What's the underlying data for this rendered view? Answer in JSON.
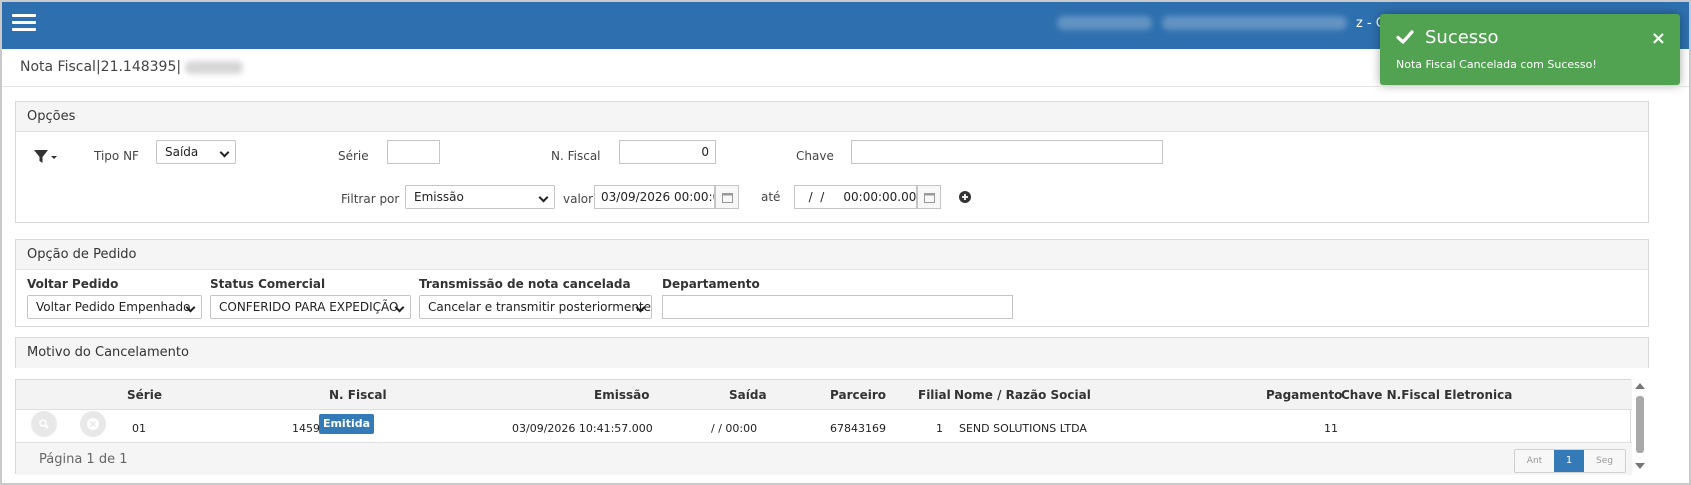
{
  "topbar": {
    "suffix": "z - C"
  },
  "toast": {
    "title": "Sucesso",
    "message": "Nota Fiscal Cancelada com Sucesso!",
    "close": "×",
    "color": "#51a351"
  },
  "page": {
    "title": "Nota Fiscal|21.148395|"
  },
  "opcoes": {
    "heading": "Opções",
    "tipo_nf_label": "Tipo NF",
    "tipo_nf_value": "Saída",
    "serie_label": "Série",
    "serie_value": "",
    "nfiscal_label": "N. Fiscal",
    "nfiscal_value": "0",
    "chave_label": "Chave",
    "chave_value": "",
    "filtrar_label": "Filtrar por",
    "filtrar_value": "Emissão",
    "valor_label": "valor",
    "valor_value": "03/09/2026 00:00:0",
    "ate_label": "até",
    "ate_value": "  /  /     00:00:00.00"
  },
  "pedido": {
    "heading": "Opção de Pedido",
    "voltar_label": "Voltar Pedido",
    "voltar_value": "Voltar Pedido Empenhado",
    "status_label": "Status Comercial",
    "status_value": "CONFERIDO PARA EXPEDIÇÃO",
    "transmissao_label": "Transmissão de nota cancelada",
    "transmissao_value": "Cancelar e transmitir posteriormente",
    "departamento_label": "Departamento",
    "departamento_value": ""
  },
  "motivo": {
    "heading": "Motivo do Cancelamento"
  },
  "grid": {
    "headers": {
      "serie": "Série",
      "nfiscal": "N. Fiscal",
      "emissao": "Emissão",
      "saida": "Saída",
      "parceiro": "Parceiro",
      "filial": "Filial",
      "nome": "Nome / Razão Social",
      "pagamento": "Pagamento",
      "chave": "Chave N.Fiscal Eletronica"
    },
    "rows": [
      {
        "serie": "01",
        "nfiscal": "1459",
        "status": "Emitida",
        "emissao": "03/09/2026 10:41:57.000",
        "saida": "/ / 00:00",
        "parceiro": "67843169",
        "filial": "1",
        "nome": "SEND SOLUTIONS LTDA",
        "pagamento": "11",
        "chave": ""
      }
    ],
    "pagination": {
      "info": "Página 1 de 1",
      "prev": "Ant",
      "current": "1",
      "next": "Seg"
    }
  },
  "colors": {
    "topbar": "#2e70af",
    "primary": "#337ab7",
    "success": "#51a351"
  }
}
